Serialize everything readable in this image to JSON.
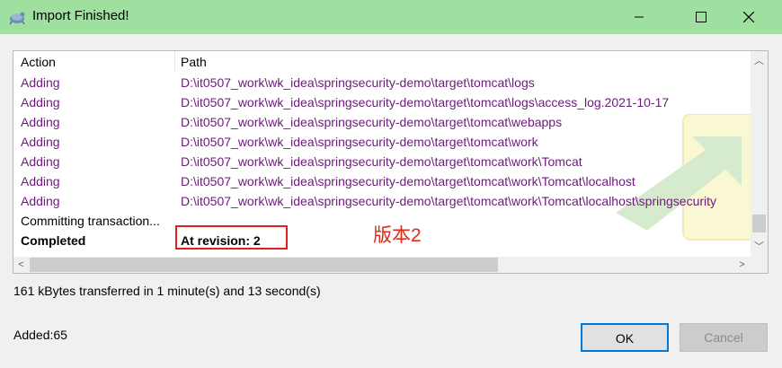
{
  "window": {
    "title": "Import Finished!"
  },
  "columns": {
    "action": "Action",
    "path": "Path"
  },
  "rows": [
    {
      "action": "Adding",
      "path": "D:\\it0507_work\\wk_idea\\springsecurity-demo\\target\\tomcat\\logs"
    },
    {
      "action": "Adding",
      "path": "D:\\it0507_work\\wk_idea\\springsecurity-demo\\target\\tomcat\\logs\\access_log.2021-10-17"
    },
    {
      "action": "Adding",
      "path": "D:\\it0507_work\\wk_idea\\springsecurity-demo\\target\\tomcat\\webapps"
    },
    {
      "action": "Adding",
      "path": "D:\\it0507_work\\wk_idea\\springsecurity-demo\\target\\tomcat\\work"
    },
    {
      "action": "Adding",
      "path": "D:\\it0507_work\\wk_idea\\springsecurity-demo\\target\\tomcat\\work\\Tomcat"
    },
    {
      "action": "Adding",
      "path": "D:\\it0507_work\\wk_idea\\springsecurity-demo\\target\\tomcat\\work\\Tomcat\\localhost"
    },
    {
      "action": "Adding",
      "path": "D:\\it0507_work\\wk_idea\\springsecurity-demo\\target\\tomcat\\work\\Tomcat\\localhost\\springsecurity"
    },
    {
      "action": "Committing transaction...",
      "path": ""
    },
    {
      "action": "Completed",
      "path": "At revision: 2"
    }
  ],
  "annotation": "版本2",
  "status": "161 kBytes transferred in 1 minute(s) and 13 second(s)",
  "added": "Added:65",
  "buttons": {
    "ok": "OK",
    "cancel": "Cancel"
  },
  "colors": {
    "titlebar": "#9fe0a0",
    "adding": "#6c1b7a",
    "highlight": "#e02020",
    "ok_border": "#0078d7"
  },
  "icons": {
    "app": "tortoise-icon"
  }
}
